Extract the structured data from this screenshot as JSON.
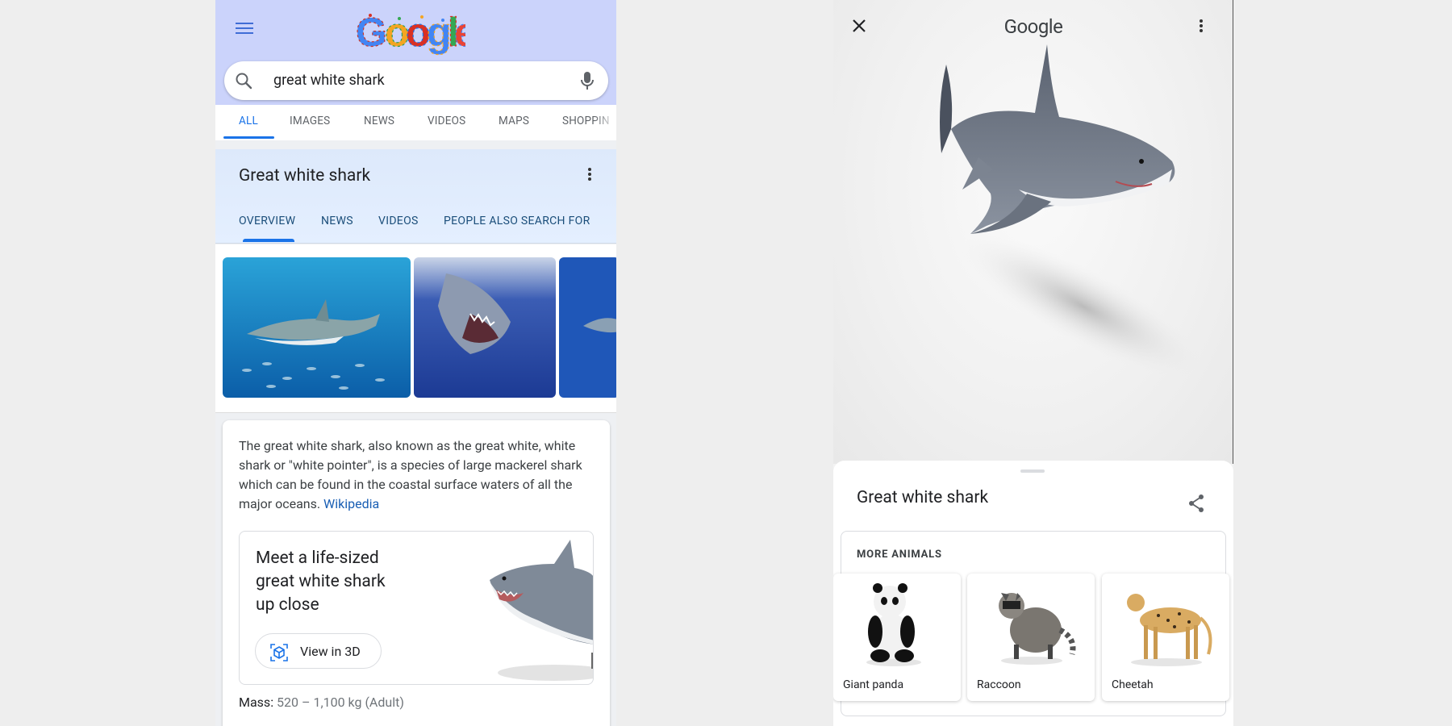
{
  "left": {
    "search": {
      "query": "great white shark"
    },
    "tabs": [
      "ALL",
      "IMAGES",
      "NEWS",
      "VIDEOS",
      "MAPS",
      "SHOPPIN"
    ],
    "knowledge_panel": {
      "title": "Great white shark",
      "tabs": [
        "OVERVIEW",
        "NEWS",
        "VIDEOS",
        "PEOPLE ALSO SEARCH FOR"
      ]
    },
    "description": {
      "text": "The great white shark, also known as the great white, white shark or \"white pointer\", is a species of large mackerel shark which can be found in the coastal surface waters of all the major oceans.",
      "link": "Wikipedia"
    },
    "promo": {
      "line1": "Meet a life-sized",
      "line2": "great white shark",
      "line3": "up close",
      "button": "View in 3D"
    },
    "mass": {
      "label": "Mass:",
      "value": "520 – 1,100 kg (Adult)"
    }
  },
  "right": {
    "header_title": "Google",
    "sheet_title": "Great white shark",
    "more_label": "MORE ANIMALS",
    "animals": [
      "Giant panda",
      "Raccoon",
      "Cheetah"
    ]
  },
  "colors": {
    "accent": "#1a73e8",
    "top_band": "#cbd3fb",
    "link": "#1a5fb4"
  },
  "icons": [
    "hamburger-icon",
    "search-icon",
    "mic-icon",
    "more-vert-icon",
    "close-icon",
    "share-icon",
    "3d-cube-icon"
  ]
}
